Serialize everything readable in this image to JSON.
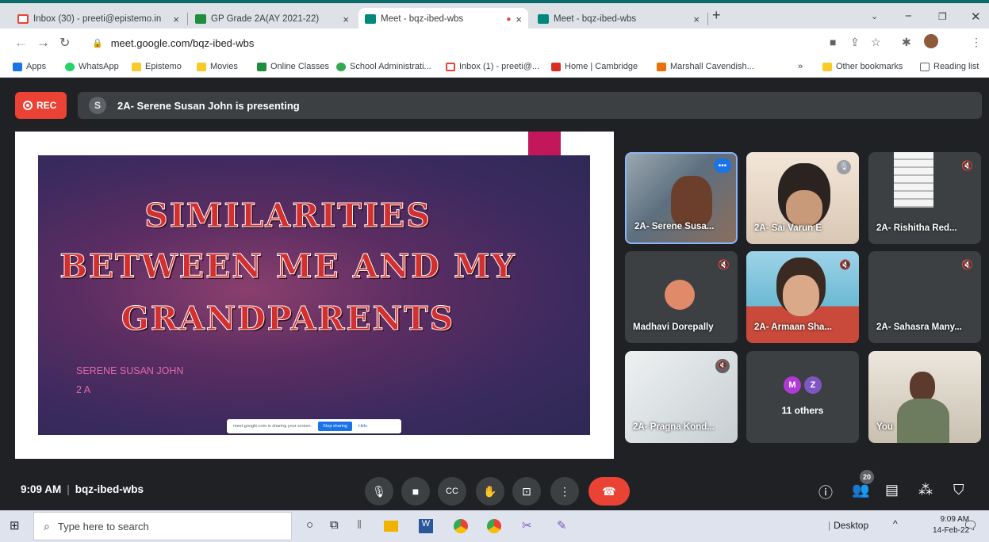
{
  "browser": {
    "tabs": [
      {
        "title": "Inbox (30) - preeti@epistemo.in",
        "close": "×"
      },
      {
        "title": "GP Grade 2A(AY 2021-22)",
        "close": "×"
      },
      {
        "title": "Meet - bqz-ibed-wbs",
        "close": "×"
      },
      {
        "title": "Meet - bqz-ibed-wbs",
        "close": "×"
      }
    ],
    "new_tab": "+",
    "url": "meet.google.com/bqz-ibed-wbs",
    "bookmarks": [
      "Apps",
      "WhatsApp",
      "Epistemo",
      "Movies",
      "Online Classes",
      "School Administrati...",
      "Inbox (1) - preeti@...",
      "Home | Cambridge",
      "Marshall Cavendish...",
      "»",
      "Other bookmarks",
      "Reading list"
    ]
  },
  "meet": {
    "rec_label": "REC",
    "presenter_initial": "S",
    "presenting_text": "2A- Serene Susan John is presenting",
    "slide": {
      "title_lines": [
        "SIMILARITIES",
        "BETWEEN ME AND MY",
        "GRANDPARENTS"
      ],
      "author": "SERENE SUSAN JOHN",
      "class": "2 A",
      "share_text": "meet.google.com is sharing your screen.",
      "stop_label": "Stop sharing",
      "hide_label": "Hide"
    },
    "tiles": [
      {
        "name": "2A- Serene Susa..."
      },
      {
        "name": "2A- Sai Varun E"
      },
      {
        "name": "2A- Rishitha Red..."
      },
      {
        "name": "Madhavi Dorepally"
      },
      {
        "name": "2A- Armaan Sha..."
      },
      {
        "name": "2A- Sahasra Many..."
      },
      {
        "name": "2A- Pragna Kond..."
      },
      {
        "name": "11 others",
        "initials": [
          "M",
          "Z"
        ]
      },
      {
        "name": "You"
      }
    ],
    "bottom": {
      "time": "9:09 AM",
      "separator": "|",
      "code": "bqz-ibed-wbs",
      "people_count": "20"
    }
  },
  "taskbar": {
    "search_placeholder": "Type here to search",
    "desktop_label": "Desktop",
    "time": "9:09 AM",
    "date": "14-Feb-22"
  },
  "colors": {
    "accent": "#1a73e8",
    "end_call": "#ea4335",
    "meet_bg": "#202124",
    "tile_bg": "#3c4043"
  }
}
